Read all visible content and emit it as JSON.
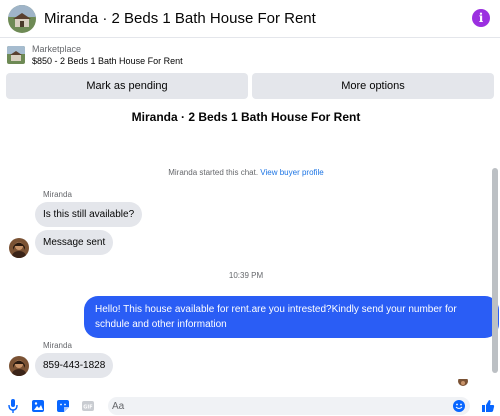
{
  "header": {
    "title": "Miranda · 2 Beds 1 Bath House For Rent",
    "info_icon_glyph": "i"
  },
  "listing": {
    "label": "Marketplace",
    "price_title": "$850 - 2 Beds 1 Bath House For Rent"
  },
  "actions": {
    "mark_pending": "Mark as pending",
    "more_options": "More options"
  },
  "chat": {
    "title": "Miranda · 2 Beds 1 Bath House For Rent",
    "started_text": "Miranda started this chat.",
    "view_profile": "View buyer profile",
    "sender_name": "Miranda",
    "messages_in_group1": [
      "Is this still available?",
      "Message sent"
    ],
    "timestamp": "10:39 PM",
    "outgoing": "Hello! This house available for rent.are you intrested?Kindly send your number for schdule and other information",
    "sender_name2": "Miranda",
    "message_in_group2": "859-443-1828"
  },
  "composer": {
    "placeholder": "Aa"
  },
  "colors": {
    "accent": "#2a5df5",
    "link": "#1b74e4",
    "info": "#9b2fe0",
    "bubble_in": "#e4e6eb"
  }
}
